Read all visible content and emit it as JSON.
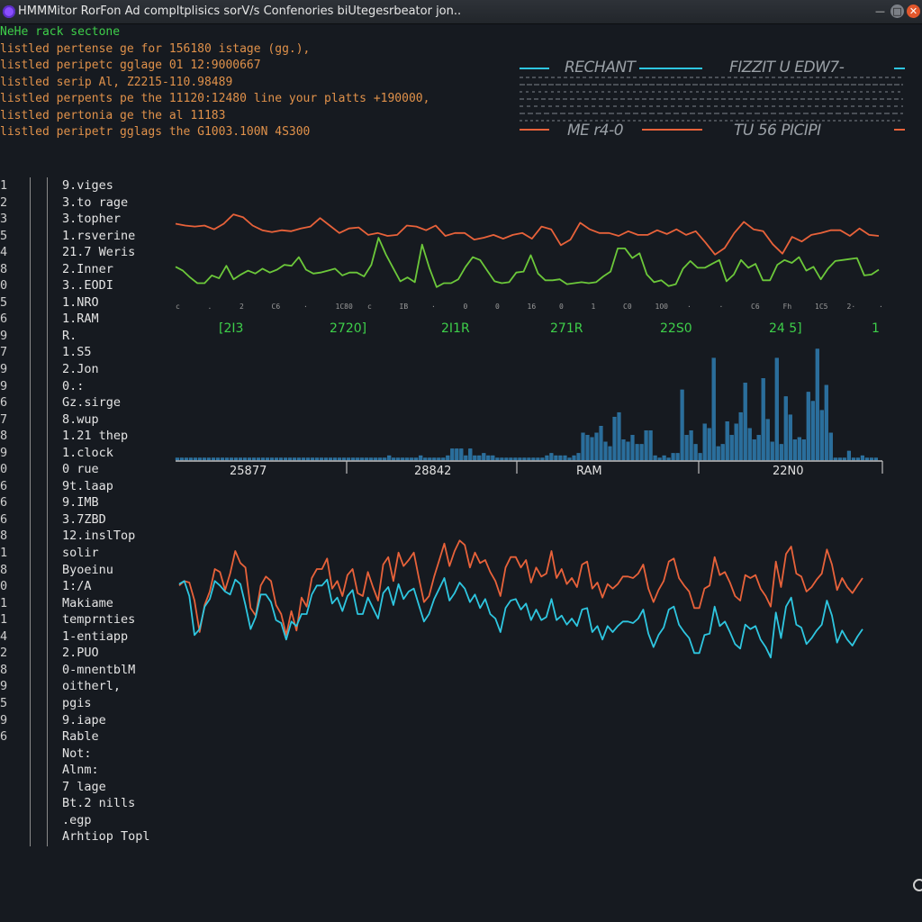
{
  "window": {
    "title": "HMMMitor RorFon Ad compltplisics sorV/s Confenories biUtegesrbeator jon.."
  },
  "log": {
    "header": "NeHe rack sectone",
    "lines": [
      "listled pertense ge for 156180 istage (gg.),",
      "listled peripetc gglage 01 12:9000667",
      "listled serip Al, Z2215-110.98489",
      "listled perpents pe the 11120:12480 line your platts +190000,",
      "listled pertonia ge the al 11183",
      "listled peripetr gglags the G1003.100N 4S300"
    ]
  },
  "legend": {
    "items": [
      "RECHANT",
      "FIZZIT  U EDW7-",
      "ME r4-0",
      "TU 56  PICIPI"
    ],
    "colors": {
      "cyan": "#2ec6e0",
      "orange": "#e8623a",
      "gray": "#6d7278"
    }
  },
  "line_numbers": [
    "1",
    "2",
    "3",
    "5",
    "4",
    "8",
    "0",
    "5",
    "6",
    "9",
    "7",
    "9",
    "9",
    "6",
    "7",
    "8",
    "9",
    "0",
    "6",
    "6",
    "6",
    "8",
    "1",
    "8",
    "0",
    "1",
    "1",
    "4",
    "2",
    "8",
    "9",
    "5",
    "9",
    "6"
  ],
  "process_list": [
    "9.viges",
    "3.to rage",
    "3.topher",
    "1.rsverine",
    "21.7 Weris",
    "2.Inner",
    "3..EODI",
    "1.NRO",
    "1.RAM",
    "R.",
    "1.S5",
    "2.Jon",
    "0.:",
    "Gz.sirge",
    "8.wup",
    "1.21 thep",
    "1.clock",
    "0 rue",
    "9t.laap",
    "9.IMB",
    "3.7ZBD",
    "12.inslTop",
    "solir",
    "Byoeinu",
    "1:/A",
    "Makiame",
    "temprnties",
    "1-entiapp",
    "2.PUO",
    "0-mnentblM",
    "oitherl,",
    "pgis",
    "9.iape",
    "Rable",
    "Not:",
    "Alnm:",
    "7 lage",
    "Bt.2 nills",
    ".egp",
    "Arhtiop Topl"
  ],
  "chart_data": [
    {
      "type": "line",
      "series": [
        {
          "color": "#e8623a",
          "values": [
            50,
            48,
            47,
            48,
            44,
            50,
            60,
            57,
            48,
            43,
            41,
            43,
            42,
            45,
            47,
            56,
            48,
            40,
            45,
            46,
            38,
            40,
            37,
            38,
            48,
            47,
            43,
            48,
            37,
            40,
            40,
            33,
            35,
            38,
            34,
            38,
            40,
            34,
            47,
            44,
            27,
            33,
            51,
            44,
            40,
            40,
            37,
            42,
            38,
            38,
            43,
            39,
            44,
            38,
            42,
            30,
            17,
            24,
            40,
            52,
            44,
            42,
            28,
            18,
            36,
            31,
            38,
            40,
            43,
            43,
            37,
            45,
            38,
            37
          ]
        },
        {
          "color": "#6cc83a",
          "values": [
            4,
            0,
            -7,
            -13,
            -13,
            -5,
            -8,
            5,
            -9,
            -4,
            0,
            -3,
            2,
            -2,
            1,
            6,
            5,
            14,
            1,
            -3,
            -2,
            0,
            2,
            -5,
            -2,
            -2,
            -6,
            6,
            34,
            17,
            3,
            -11,
            -7,
            -12,
            27,
            3,
            -17,
            -13,
            -13,
            -9,
            4,
            14,
            11,
            0,
            -11,
            -13,
            -12,
            -2,
            -1,
            16,
            -3,
            -10,
            -10,
            -9,
            -14,
            -13,
            -12,
            -13,
            -12,
            -6,
            -1,
            23,
            23,
            13,
            18,
            -4,
            -12,
            -10,
            -16,
            -14,
            2,
            10,
            3,
            3,
            7,
            11,
            -11,
            -4,
            11,
            3,
            7,
            -10,
            -10,
            6,
            11,
            8,
            14,
            0,
            4,
            -9,
            2,
            10,
            11,
            12,
            13,
            -5,
            -4,
            1
          ]
        }
      ]
    },
    {
      "type": "bar",
      "values": [
        1,
        1,
        1,
        1,
        1,
        1,
        1,
        1,
        1,
        1,
        1,
        1,
        1,
        1,
        1,
        1,
        1,
        1,
        1,
        1,
        1,
        1,
        1,
        1,
        1,
        1,
        1,
        1,
        1,
        1,
        1,
        1,
        1,
        1,
        1,
        1,
        1,
        1,
        1,
        1,
        1,
        1,
        1,
        1,
        1,
        1,
        1,
        2,
        1,
        1,
        1,
        1,
        1,
        1,
        2,
        1,
        1,
        1,
        1,
        1,
        2,
        5,
        5,
        5,
        2,
        5,
        2,
        2,
        3,
        2,
        2,
        1,
        1,
        1,
        1,
        1,
        1,
        1,
        1,
        1,
        1,
        1,
        2,
        3,
        2,
        2,
        2,
        1,
        2,
        3,
        12,
        11,
        10,
        12,
        15,
        8,
        6,
        19,
        21,
        9,
        8,
        11,
        7,
        7,
        13,
        13,
        2,
        1,
        2,
        1,
        3,
        3,
        31,
        11,
        13,
        7,
        3,
        16,
        14,
        45,
        6,
        7,
        17,
        11,
        16,
        21,
        34,
        14,
        9,
        11,
        36,
        18,
        8,
        45,
        7,
        28,
        20,
        9,
        10,
        9,
        30,
        26,
        49,
        22,
        33,
        12,
        1,
        1,
        1,
        4,
        1,
        1,
        2,
        1,
        1,
        1
      ],
      "labels": [
        "25877",
        "28842",
        "RAM",
        "22N0"
      ]
    },
    {
      "type": "line",
      "series": [
        {
          "color": "#e8623a",
          "values": [
            60,
            63,
            62,
            50,
            29,
            47,
            56,
            71,
            69,
            57,
            68,
            83,
            75,
            72,
            45,
            40,
            60,
            66,
            63,
            47,
            41,
            27,
            43,
            30,
            52,
            46,
            65,
            71,
            71,
            78,
            58,
            63,
            53,
            67,
            71,
            55,
            53,
            69,
            59,
            50,
            74,
            79,
            63,
            82,
            73,
            77,
            82,
            65,
            49,
            53,
            66,
            77,
            88,
            73,
            83,
            90,
            87,
            72,
            82,
            75,
            77,
            69,
            63,
            53,
            72,
            79,
            79,
            72,
            77,
            62,
            72,
            66,
            68,
            83,
            65,
            71,
            61,
            65,
            59,
            74,
            76,
            58,
            62,
            52,
            61,
            58,
            61,
            66,
            66,
            65,
            68,
            74,
            58,
            49,
            57,
            63,
            76,
            78,
            65,
            60,
            56,
            45,
            45,
            58,
            60,
            79,
            67,
            69,
            62,
            53,
            50,
            67,
            65,
            67,
            58,
            53,
            46,
            76,
            59,
            81,
            86,
            68,
            66,
            56,
            59,
            64,
            68,
            84,
            74,
            57,
            65,
            59,
            55,
            60,
            65
          ]
        },
        {
          "color": "#2ec6e0",
          "values": [
            61,
            63,
            53,
            27,
            31,
            46,
            51,
            63,
            60,
            56,
            54,
            64,
            61,
            47,
            31,
            39,
            54,
            54,
            49,
            37,
            35,
            24,
            36,
            33,
            41,
            41,
            54,
            60,
            60,
            64,
            48,
            52,
            43,
            53,
            57,
            41,
            41,
            52,
            45,
            38,
            55,
            59,
            47,
            61,
            51,
            56,
            58,
            47,
            36,
            41,
            51,
            58,
            65,
            50,
            55,
            62,
            58,
            49,
            54,
            45,
            51,
            41,
            38,
            29,
            45,
            50,
            51,
            44,
            48,
            37,
            44,
            37,
            39,
            51,
            37,
            40,
            34,
            38,
            33,
            44,
            45,
            29,
            33,
            24,
            33,
            29,
            33,
            36,
            36,
            35,
            38,
            44,
            28,
            19,
            27,
            32,
            44,
            46,
            34,
            29,
            25,
            15,
            15,
            27,
            28,
            46,
            33,
            36,
            29,
            21,
            18,
            34,
            31,
            33,
            24,
            19,
            12,
            42,
            25,
            46,
            52,
            34,
            32,
            21,
            25,
            30,
            34,
            50,
            40,
            22,
            30,
            24,
            20,
            26,
            31
          ]
        }
      ]
    }
  ],
  "midlabels": [
    "[2I3",
    "2720]",
    "2I1R",
    "271R",
    "22S0",
    "24 5]",
    "1"
  ]
}
